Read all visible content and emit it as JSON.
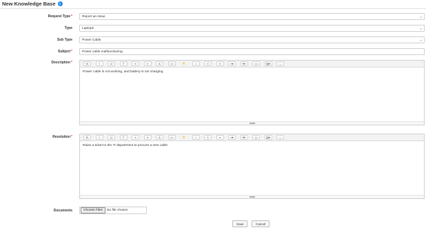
{
  "page": {
    "title": "New Knowledge Base",
    "info_icon": "info-icon"
  },
  "form": {
    "request_type": {
      "label": "Request Type",
      "value": "Report an issue"
    },
    "type": {
      "label": "Type",
      "value": "Laptops"
    },
    "sub_type": {
      "label": "Sub Type",
      "value": "Power Cable"
    },
    "subject": {
      "label": "Subject",
      "value": "Power cable malfunctioning"
    },
    "description": {
      "label": "Description",
      "content": "Power cable is not working, and battery is not charging."
    },
    "resolution": {
      "label": "Resolution",
      "content": "Raise a ticket to the IT department to procure a new cable"
    },
    "documents": {
      "label": "Documents",
      "button": "Choose Files",
      "status": "No file chosen"
    },
    "required_marker": "*"
  },
  "toolbar": [
    "B",
    "I",
    "U",
    "T",
    "≡",
    "≡",
    "A",
    "<>",
    "A",
    "•",
    "≡",
    "≡",
    "≡▾",
    "¶▾",
    "▭",
    "▤▾",
    "↔"
  ],
  "actions": {
    "save": "Save",
    "cancel": "Cancel"
  },
  "colors": {
    "required": "#d32f2f",
    "info": "#1e88e5",
    "warning": "#e6b800"
  }
}
